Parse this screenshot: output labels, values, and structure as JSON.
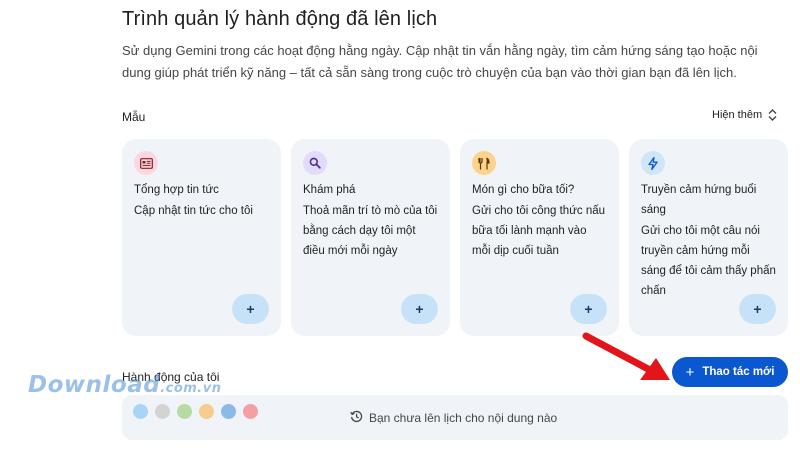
{
  "header": {
    "title": "Trình quản lý hành động đã lên lịch",
    "description": "Sử dụng Gemini trong các hoạt động hằng ngày. Cập nhật tin vắn hằng ngày, tìm cảm hứng sáng tạo hoặc nội dung giúp phát triển kỹ năng – tất cả sẵn sàng trong cuộc trò chuyện của bạn vào thời gian bạn đã lên lịch."
  },
  "templates": {
    "label": "Mẫu",
    "show_more": "Hiện thêm",
    "add_symbol": "+",
    "cards": [
      {
        "title": "Tổng hợp tin tức",
        "desc": "Cập nhật tin tức cho tôi",
        "icon": "newspaper-icon",
        "icon_bg": "#fbd7e3",
        "icon_color": "#b3261e"
      },
      {
        "title": "Khám phá",
        "desc": "Thoả mãn trí tò mò của tôi bằng cách dạy tôi một điều mới mỗi ngày",
        "icon": "search-icon",
        "icon_bg": "#e3dbfb",
        "icon_color": "#5b3fb0"
      },
      {
        "title": "Món gì cho bữa tối?",
        "desc": "Gửi cho tôi công thức nấu bữa tối lành mạnh vào mỗi dịp cuối tuần",
        "icon": "fork-knife-icon",
        "icon_bg": "#fbd38d",
        "icon_color": "#6b3e00"
      },
      {
        "title": "Truyền cảm hứng buổi sáng",
        "desc": "Gửi cho tôi một câu nói truyền cảm hứng mỗi sáng để tôi cảm thấy phấn chấn",
        "icon": "lightning-icon",
        "icon_bg": "#cfe6f7",
        "icon_color": "#0b57d0"
      }
    ]
  },
  "my_actions": {
    "label": "Hành động của tôi",
    "new_button": "Thao tác mới",
    "new_button_symbol": "+",
    "empty_text": "Bạn chưa lên lịch cho nội dung nào",
    "dot_colors": [
      "#a8d4f5",
      "#d3d3d3",
      "#b6dba4",
      "#f6cc8f",
      "#8db9e6",
      "#f2a0a4"
    ]
  },
  "watermark": {
    "brand": "Download",
    "suffix": ".com.vn"
  },
  "colors": {
    "accent": "#0b57d0",
    "card_bg": "#f0f4f9",
    "arrow": "#e3151a"
  }
}
